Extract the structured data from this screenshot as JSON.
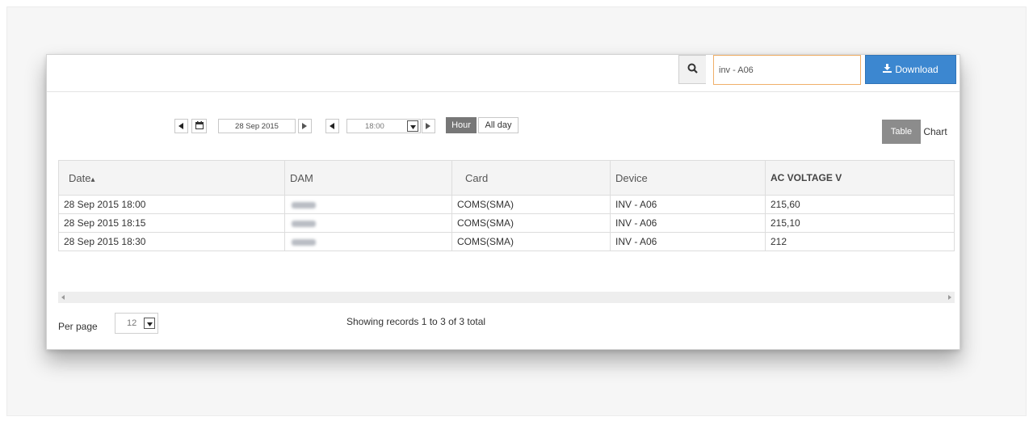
{
  "search": {
    "value": "inv - A06"
  },
  "download": {
    "label": "Download",
    "icon": "download-icon"
  },
  "date_nav": {
    "date": "28 Sep 2015",
    "time": "18:00"
  },
  "range": {
    "hour": "Hour",
    "all_day": "All day"
  },
  "view_tabs": {
    "table": "Table",
    "chart": "Chart"
  },
  "table": {
    "columns": [
      "Date",
      "DAM",
      "Card",
      "Device",
      "AC VOLTAGE V"
    ],
    "sort_indicator": "▴",
    "rows": [
      {
        "date": "28 Sep 2015 18:00",
        "card": "COMS(SMA)",
        "device": "INV - A06",
        "ac_voltage": "215,60"
      },
      {
        "date": "28 Sep 2015 18:15",
        "card": "COMS(SMA)",
        "device": "INV - A06",
        "ac_voltage": "215,10"
      },
      {
        "date": "28 Sep 2015 18:30",
        "card": "COMS(SMA)",
        "device": "INV - A06",
        "ac_voltage": "212"
      }
    ]
  },
  "footer": {
    "per_page_label": "Per page",
    "per_page_value": "12",
    "showing": "Showing records 1 to 3 of 3 total"
  },
  "colors": {
    "accent": "#3c87d0",
    "search_border": "#f0b06a",
    "active_tab": "#8c8c8c",
    "hour_active": "#777777"
  }
}
